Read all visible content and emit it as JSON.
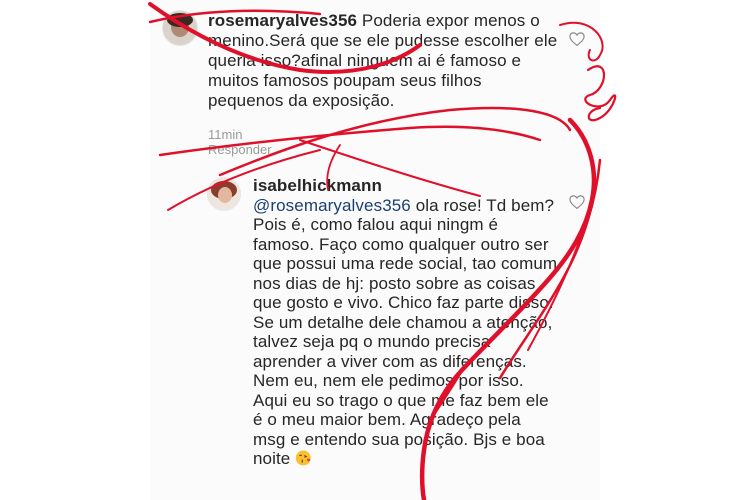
{
  "comment1": {
    "username": "rosemaryalves356",
    "text": "Poderia expor menos o menino.Será que se ele pudesse escolher ele queria isso?afinal ninguem ai é famoso e muitos famosos poupam seus filhos pequenos da exposição.",
    "time": "11min",
    "reply_label": "Responder"
  },
  "comment2": {
    "username": "isabelhickmann",
    "mention": "@rosemaryalves356",
    "text": "ola rose! Td bem? Pois é, como falou aqui ningm é famoso. Faço como qualquer outro ser que possui uma rede social, tao comum nos dias de hj: posto sobre as coisas que gosto e vivo. Chico faz parte disso. Se um detalhe dele chamou a atenção, talvez seja pq o mundo precisa aprender a viver com as diferenças. Nem eu, nem ele pedimos por isso. Aqui eu so trago o que me faz bem ele é o meu maior bem. Agradeço pela msg e entendo sua posição. Bjs e boa noite",
    "emoji": "face-blowing-kiss"
  },
  "icons": {
    "like": "heart-outline-icon"
  },
  "colors": {
    "mention": "#1a3f73",
    "annotation": "#e0102a",
    "meta": "#9a9a9a"
  }
}
